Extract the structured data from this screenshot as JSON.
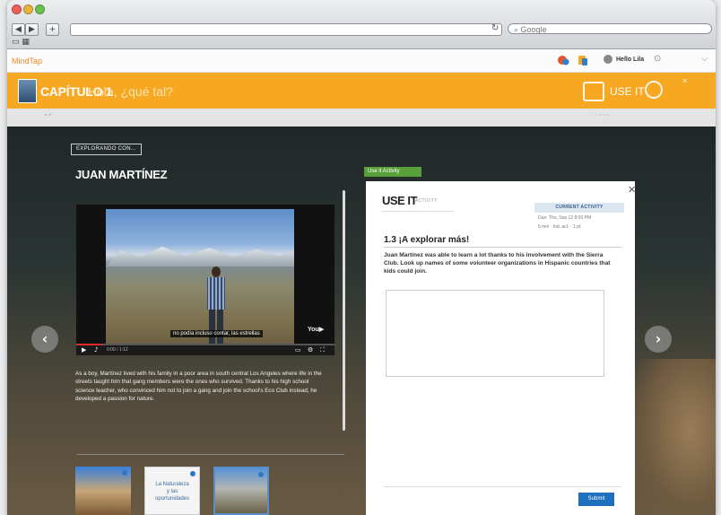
{
  "browser": {
    "search_placeholder": "Google",
    "reload_glyph": "↻",
    "back_glyph": "◀",
    "forward_glyph": "▶",
    "add_glyph": "+"
  },
  "app": {
    "brand": "MindTap",
    "user_name": "Hello Lila"
  },
  "chapter": {
    "title": "CAPÍTULO 1",
    "subtitle": "Hola, ¿qué tal?",
    "useit_label": "USE IT"
  },
  "content": {
    "tag": "EXPLORANDO CON...",
    "person": "JUAN MARTÍNEZ",
    "video_caption": "no podía incluso contar, las estrellas",
    "video_time": "0:00 / 1:12",
    "paragraph": "As a boy, Martínez lived with his family in a poor area in south central Los Angeles where life in the streets taught him that gang members were the ones who survived. Thanks to his high school science teacher, who convinced him not to join a gang and join the school's Eco Club instead, he developed a passion for nature.",
    "thumbnails": [
      {
        "label": ""
      },
      {
        "label_lines": [
          "La Naturaleza",
          "y las",
          "oportunidades"
        ]
      },
      {
        "label": ""
      }
    ]
  },
  "panel": {
    "green_pill": "Use it Activity",
    "title": "USE IT",
    "subtitle": "ACTIVITY",
    "current_activity": "CURRENT ACTIVITY",
    "due_line": "Due: Thu, Sep 12 8:00 PM",
    "meta_line": "5 min  ·  Ind. act.  ·  1 pt",
    "activity_title": "1.3 ¡A explorar más!",
    "prompt": "Juan Martínez was able to learn a lot thanks to his involvement with the Sierra Club. Look up names of some volunteer organizations in Hispanic countries that kids could join.",
    "submit_label": "Submit",
    "close_glyph": "✕"
  }
}
